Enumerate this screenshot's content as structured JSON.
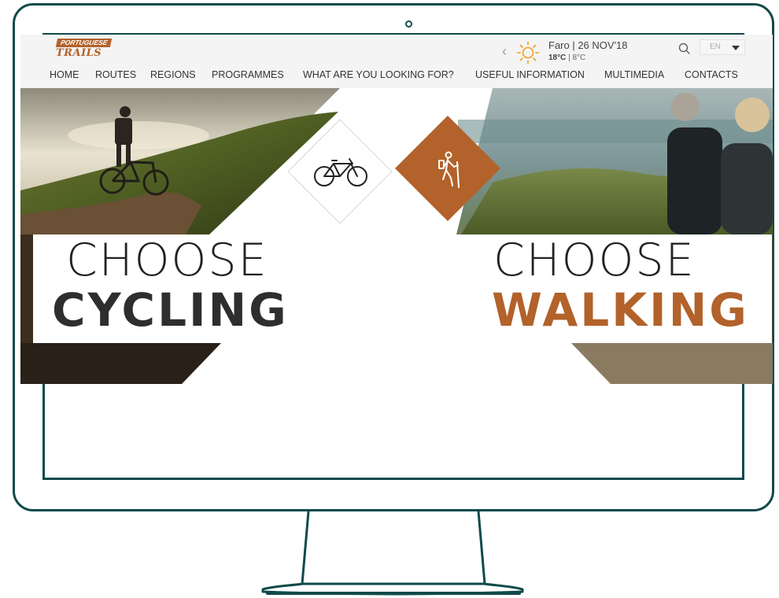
{
  "site": {
    "logo": {
      "top": "PORTUGUESE",
      "bottom": "TRAILS"
    },
    "weather": {
      "prev_glyph": "‹",
      "location_date": "Faro | 26 NOV'18",
      "temp_high": "18°C",
      "temp_sep": " | ",
      "temp_low": "8°C",
      "icon": "sun-icon"
    },
    "search": {
      "icon": "search-icon"
    },
    "language": {
      "selected": "EN"
    },
    "nav": {
      "home": "HOME",
      "routes": "ROUTES",
      "regions": "REGIONS",
      "programmes": "PROGRAMMES",
      "looking_for": "WHAT ARE YOU LOOKING FOR?",
      "useful_info": "USEFUL INFORMATION",
      "multimedia": "MULTIMEDIA",
      "contacts": "CONTACTS"
    },
    "hero": {
      "cycling": {
        "choose": "CHOOSE",
        "activity": "CYCLING",
        "icon": "bicycle-icon"
      },
      "walking": {
        "choose": "CHOOSE",
        "activity": "WALKING",
        "icon": "hiker-icon"
      }
    }
  },
  "colors": {
    "frame": "#0f4a4a",
    "brand": "#b2622a",
    "cycling_text": "#2e2e2e",
    "walking_text": "#b2622a",
    "header_bg": "#f4f4f4"
  }
}
